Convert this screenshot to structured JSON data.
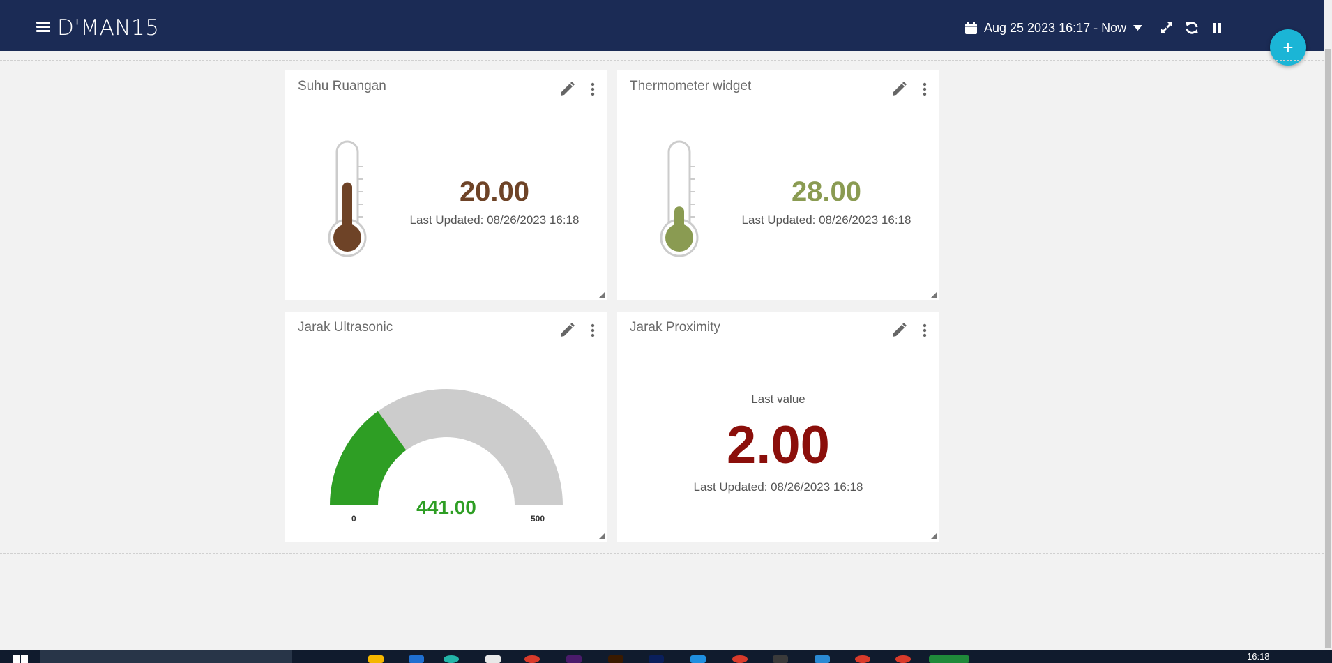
{
  "header": {
    "brand": "D'MAN15",
    "date_range": "Aug 25 2023 16:17 - Now"
  },
  "fab": {
    "label": "+"
  },
  "widgets": {
    "w1": {
      "title": "Suhu Ruangan",
      "value": "20.00",
      "updated": "Last Updated: 08/26/2023 16:18",
      "color": "#6e4327",
      "fill_fraction": 0.62
    },
    "w2": {
      "title": "Thermometer widget",
      "value": "28.00",
      "updated": "Last Updated: 08/26/2023 16:18",
      "color": "#8a9b52",
      "fill_fraction": 0.35
    },
    "w3": {
      "title": "Jarak Ultrasonic",
      "value": "441.00",
      "min": "0",
      "max": "500",
      "color": "#2e9e24",
      "gauge_value": 441,
      "gauge_min": 0,
      "gauge_max": 500
    },
    "w4": {
      "title": "Jarak Proximity",
      "label": "Last value",
      "value": "2.00",
      "updated": "Last Updated: 08/26/2023 16:18",
      "color": "#8b0f0b"
    }
  },
  "taskbar": {
    "clock": "16:18"
  }
}
